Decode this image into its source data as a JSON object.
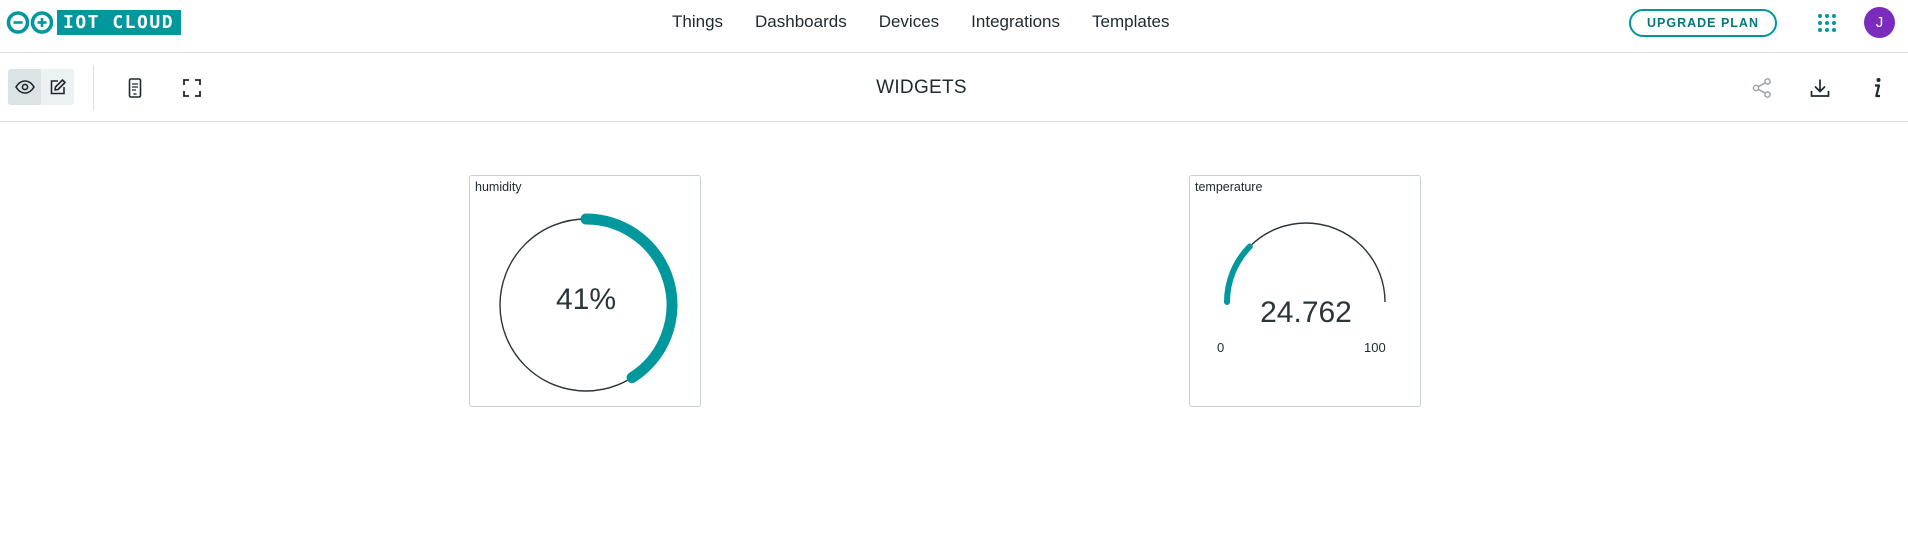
{
  "brand": {
    "logo_text": "IOT CLOUD",
    "accent": "#00979d"
  },
  "nav": {
    "items": [
      "Things",
      "Dashboards",
      "Devices",
      "Integrations",
      "Templates"
    ]
  },
  "header_actions": {
    "upgrade_label": "UPGRADE PLAN",
    "apps_icon": "grid-icon",
    "avatar_initial": "J",
    "avatar_color": "#7b2cbf"
  },
  "toolbar": {
    "title": "WIDGETS",
    "icons": [
      "eye-icon",
      "edit-icon",
      "mobile-view-icon",
      "fullscreen-icon",
      "share-icon",
      "download-icon",
      "info-icon"
    ]
  },
  "widgets": [
    {
      "label": "humidity",
      "type": "percentage",
      "value": 41,
      "display": "41%"
    },
    {
      "label": "temperature",
      "type": "gauge",
      "value": 24.762,
      "display": "24.762",
      "min": 0,
      "max": 100,
      "min_label": "0",
      "max_label": "100"
    }
  ]
}
